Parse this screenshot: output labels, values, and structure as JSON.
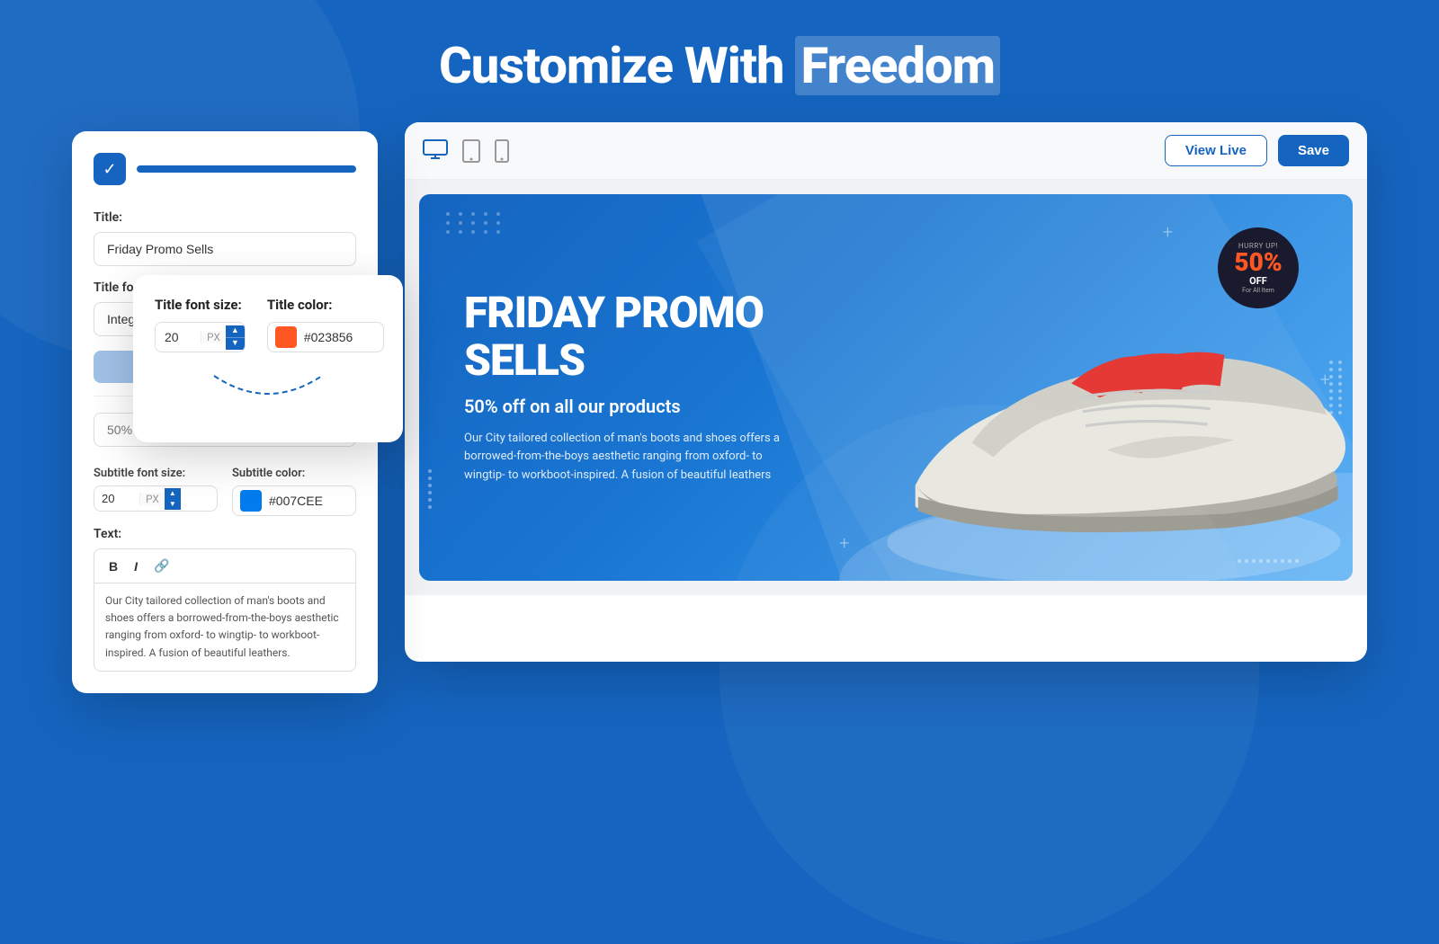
{
  "page": {
    "title_part1": "Customize With ",
    "title_part2": "Freedom"
  },
  "editor": {
    "logo_icon": "✓",
    "title_label": "Title:",
    "title_value": "Friday Promo Sells",
    "title_placeholder": "Friday Promo Sells",
    "font_label": "Title font:",
    "font_value": "Integral Crf Bold",
    "blue_button_label": "...",
    "subtitle_input_placeholder": "50% off on all our products",
    "subtitle_font_size_label": "Subtitle font size:",
    "subtitle_font_size_value": "20",
    "subtitle_font_unit": "PX",
    "subtitle_color_label": "Subtitle color:",
    "subtitle_color_hex": "#007CEE",
    "subtitle_color_swatch": "#007CEE",
    "text_label": "Text:",
    "text_content": "Our City tailored collection of man's boots and shoes offers a borrowed-from-the-boys aesthetic ranging from oxford- to wingtip- to workboot-inspired. A fusion of beautiful leathers.",
    "toolbar_bold": "B",
    "toolbar_italic": "I",
    "toolbar_link": "🔗"
  },
  "floating": {
    "title_font_size_label": "Title font size:",
    "title_font_size_value": "20",
    "title_font_unit": "PX",
    "title_color_label": "Title color:",
    "title_color_hex": "#023856",
    "title_color_swatch": "#FF5722"
  },
  "preview": {
    "device_desktop": "🖥",
    "device_tablet": "⬜",
    "device_mobile": "📱",
    "view_live_label": "View Live",
    "save_label": "Save",
    "banner": {
      "title": "FRIDAY PROMO SELLS",
      "subtitle": "50% off on all our products",
      "text": "Our City tailored collection of man's boots and shoes offers a borrowed-from-the-boys aesthetic ranging from oxford- to wingtip- to workboot-inspired. A fusion of beautiful leathers",
      "badge_hurry": "Hurry Up!",
      "badge_percent": "50%",
      "badge_off": "OFF",
      "badge_sub": "For All Item"
    }
  }
}
